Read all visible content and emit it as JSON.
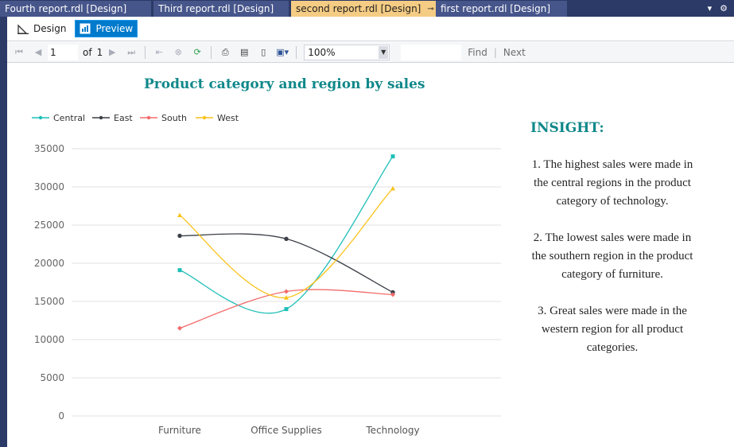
{
  "tabs": [
    {
      "label": "Fourth report.rdl [Design]",
      "active": false
    },
    {
      "label": "Third report.rdl [Design]",
      "active": false
    },
    {
      "label": "second report.rdl [Design]",
      "active": true
    },
    {
      "label": "first report.rdl [Design]",
      "active": false
    }
  ],
  "tab_icons": {
    "pin": "pin-icon",
    "close": "close-icon",
    "menu": "dropdown-icon",
    "settings": "gear-icon"
  },
  "view_buttons": {
    "design": "Design",
    "preview": "Preview"
  },
  "toolbar": {
    "page_current": "1",
    "page_of": "of",
    "page_total": "1",
    "zoom": "100%",
    "find": "Find",
    "next": "Next"
  },
  "chart_data": {
    "type": "line",
    "title": "Product category and region by sales",
    "categories": [
      "Furniture",
      "Office Supplies",
      "Technology"
    ],
    "series": [
      {
        "name": "Central",
        "values": [
          19100,
          14000,
          34000
        ],
        "color": "#1fbfb8"
      },
      {
        "name": "East",
        "values": [
          23600,
          23200,
          16200
        ],
        "color": "#3b3f47"
      },
      {
        "name": "South",
        "values": [
          11500,
          16300,
          15900
        ],
        "color": "#f36b6b"
      },
      {
        "name": "West",
        "values": [
          26300,
          15500,
          29800
        ],
        "color": "#f9c21a"
      }
    ],
    "yticks": [
      0,
      5000,
      10000,
      15000,
      20000,
      25000,
      30000,
      35000
    ],
    "ylim": [
      0,
      35000
    ],
    "legend": "top-left",
    "grid": true
  },
  "insight": {
    "heading": "INSIGHT:",
    "points": [
      "1. The highest sales were made in the central regions in the product category of technology.",
      "2. The lowest sales were made in the southern region in the product category of furniture.",
      "3. Great sales were made in the western region for all product categories."
    ]
  }
}
